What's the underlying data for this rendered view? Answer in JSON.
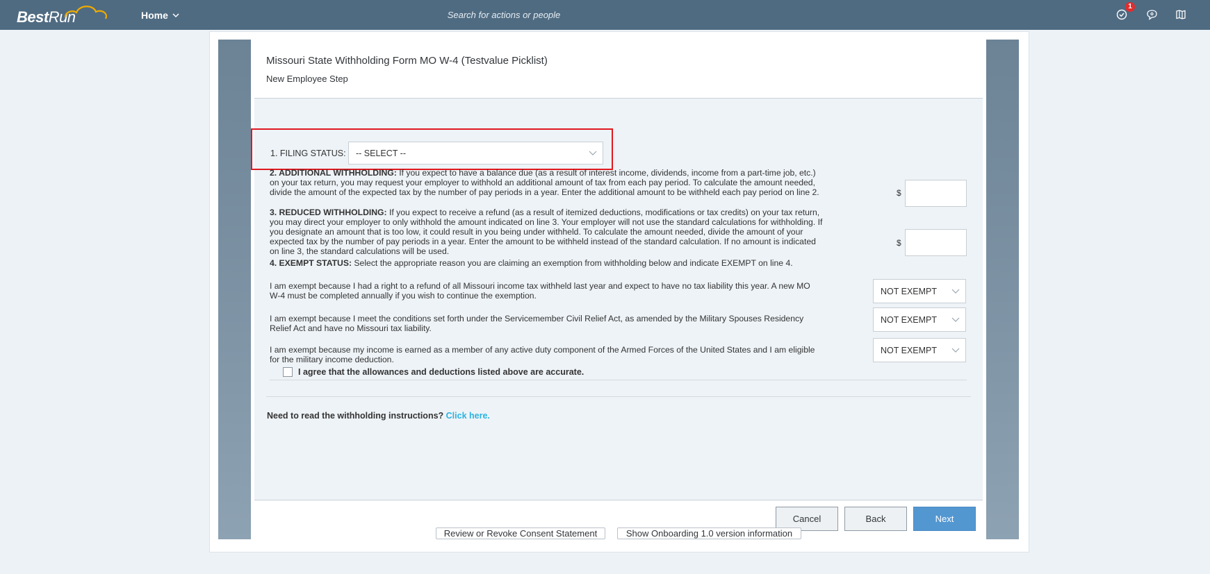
{
  "header": {
    "logo_bold": "Best",
    "logo_light": "Run",
    "home_label": "Home",
    "search_placeholder": "Search for actions or people",
    "notifications_count": "1",
    "icons": [
      "check-circle-icon",
      "chat-icon",
      "map-book-icon"
    ]
  },
  "form": {
    "title": "Missouri State Withholding Form MO W-4 (Testvalue Picklist)",
    "subtitle": "New Employee Step",
    "filing_status": {
      "label": "1. FILING STATUS:",
      "selected": "-- SELECT --"
    },
    "additional_withholding": {
      "heading": "2. ADDITIONAL WITHHOLDING:",
      "text": " If you expect to have a balance due (as a result of interest income, dividends, income from a part-time job, etc.) on your tax return, you may request your employer to withhold an additional amount of tax from each pay period. To calculate the amount needed, divide the amount of the expected tax by the number of pay periods in a year. Enter the additional amount to be withheld each pay period on line 2.",
      "currency": "$",
      "value": ""
    },
    "reduced_withholding": {
      "heading": "3. REDUCED WITHHOLDING:",
      "text": " If you expect to receive a refund (as a result of itemized deductions, modifications or tax credits) on your tax return, you may direct your employer to only withhold the amount indicated on line 3. Your employer will not use the standard calculations for withholding. If you designate an amount that is too low, it could result in you being under withheld. To calculate the amount needed, divide the amount of your expected tax by the number of pay periods in a year. Enter the amount to be withheld instead of the standard calculation. If no amount is indicated on line 3, the standard calculations will be used.",
      "currency": "$",
      "value": ""
    },
    "exempt_status": {
      "heading": "4. EXEMPT STATUS:",
      "text": " Select the appropriate reason you are claiming an exemption from withholding below and indicate EXEMPT on line 4."
    },
    "exemptions": [
      {
        "text": "I am exempt because I had a right to a refund of all Missouri income tax withheld last year and expect to have no tax liability this year. A new MO W-4 must be completed annually if you wish to continue the exemption.",
        "selected": "NOT EXEMPT"
      },
      {
        "text": "I am exempt because I meet the conditions set forth under the Servicemember Civil Relief Act, as amended by the Military Spouses Residency Relief Act and have no Missouri tax liability.",
        "selected": "NOT EXEMPT"
      },
      {
        "text": "I am exempt because my income is earned as a member of any active duty component of the Armed Forces of the United States and I am eligible for the military income deduction.",
        "selected": "NOT EXEMPT"
      }
    ],
    "agree_label": "I agree that the allowances and deductions listed above are accurate.",
    "instructions_question": "Need to read the withholding instructions?",
    "instructions_link": "Click here."
  },
  "footer": {
    "cancel": "Cancel",
    "back": "Back",
    "next": "Next",
    "consent_link": "Review or Revoke Consent Statement",
    "version_link": "Show Onboarding 1.0 version information"
  },
  "colors": {
    "shell_bar": "#4f6b82",
    "highlight_border": "#e0181e",
    "primary_button": "#5397d1",
    "link": "#2ab3e0"
  }
}
